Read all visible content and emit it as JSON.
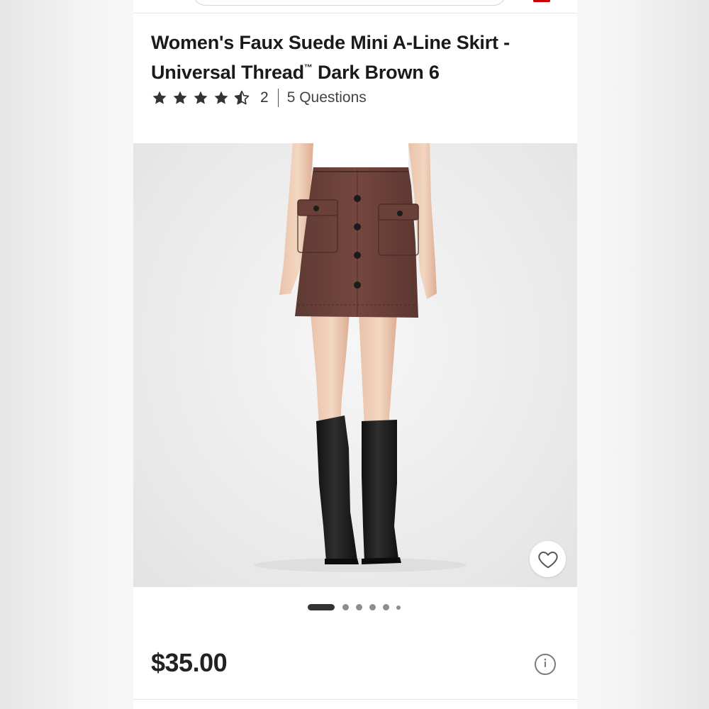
{
  "product": {
    "title_main": "Women's Faux Suede Mini A-Line Skirt - Universal Thread",
    "title_tm": "™",
    "title_end": " Dark Brown 6",
    "rating": 4.5,
    "review_count": "2",
    "questions": "5 Questions",
    "price": "$35.00"
  },
  "gallery": {
    "image_count": 6,
    "active_index": 0
  },
  "icons": {
    "stars": "star-icon",
    "favorite": "heart-icon",
    "info": "info-icon"
  },
  "colors": {
    "brand_red": "#cc0000",
    "star": "#333333",
    "skirt": "#6b4038"
  }
}
